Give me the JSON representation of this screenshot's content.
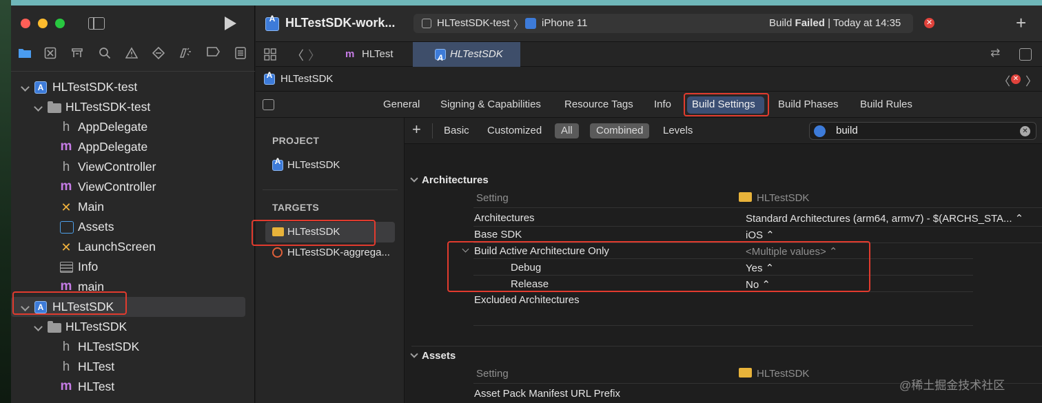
{
  "navigator": {
    "tree": [
      {
        "label": "HLTestSDK-test",
        "icon": "project-icon",
        "level": 0,
        "disclosure": true
      },
      {
        "label": "HLTestSDK-test",
        "icon": "folder-icon",
        "level": 1,
        "disclosure": true
      },
      {
        "label": "AppDelegate",
        "icon": "h-file-icon",
        "level": 2
      },
      {
        "label": "AppDelegate",
        "icon": "m-file-icon",
        "level": 2
      },
      {
        "label": "ViewController",
        "icon": "h-file-icon",
        "level": 2
      },
      {
        "label": "ViewController",
        "icon": "m-file-icon",
        "level": 2
      },
      {
        "label": "Main",
        "icon": "storyboard-icon",
        "level": 2
      },
      {
        "label": "Assets",
        "icon": "assets-icon",
        "level": 2
      },
      {
        "label": "LaunchScreen",
        "icon": "storyboard-icon",
        "level": 2
      },
      {
        "label": "Info",
        "icon": "plist-icon",
        "level": 2
      },
      {
        "label": "main",
        "icon": "m-file-icon",
        "level": 2
      },
      {
        "label": "HLTestSDK",
        "icon": "project-icon",
        "level": 0,
        "disclosure": true,
        "selected": true
      },
      {
        "label": "HLTestSDK",
        "icon": "folder-icon",
        "level": 1,
        "disclosure": true
      },
      {
        "label": "HLTestSDK",
        "icon": "h-file-icon",
        "level": 2
      },
      {
        "label": "HLTest",
        "icon": "h-file-icon",
        "level": 2
      },
      {
        "label": "HLTest",
        "icon": "m-file-icon",
        "level": 2
      }
    ]
  },
  "toolbar": {
    "title": "HLTestSDK-work...",
    "scheme": "HLTestSDK-test",
    "device": "iPhone 11",
    "status_prefix": "Build",
    "status_bold": "Failed",
    "status_suffix": "| Today at 14:35",
    "error_glyph": "✕",
    "add_glyph": "+"
  },
  "tabs": [
    {
      "label": "HLTest",
      "icon": "m-file-icon",
      "active": false
    },
    {
      "label": "HLTestSDK",
      "icon": "project-icon",
      "active": true
    }
  ],
  "jumpbar": {
    "label": "HLTestSDK"
  },
  "settings_tabs": [
    "General",
    "Signing & Capabilities",
    "Resource Tags",
    "Info",
    "Build Settings",
    "Build Phases",
    "Build Rules"
  ],
  "targets_panel": {
    "project_header": "PROJECT",
    "project_item": "HLTestSDK",
    "targets_header": "TARGETS",
    "targets": [
      "HLTestSDK",
      "HLTestSDK-aggrega..."
    ]
  },
  "filters": {
    "add": "+",
    "buttons": [
      "Basic",
      "Customized",
      "All",
      "Combined",
      "Levels"
    ],
    "search_value": "build"
  },
  "sections": {
    "architectures": {
      "title": "Architectures",
      "col_setting": "Setting",
      "col_target": "HLTestSDK",
      "rows": [
        {
          "name": "Architectures",
          "value": "Standard Architectures (arm64, armv7)  -  $(ARCHS_STA... ⌃"
        },
        {
          "name": "Base SDK",
          "value": "iOS ⌃"
        },
        {
          "name": "Build Active Architecture Only",
          "value": "<Multiple values> ⌃"
        },
        {
          "name": "Debug",
          "value": "Yes ⌃"
        },
        {
          "name": "Release",
          "value": "No ⌃"
        },
        {
          "name": "Excluded Architectures",
          "value": ""
        }
      ]
    },
    "assets": {
      "title": "Assets",
      "col_setting": "Setting",
      "col_target": "HLTestSDK",
      "rows": [
        {
          "name": "Asset Pack Manifest URL Prefix",
          "value": ""
        }
      ]
    }
  },
  "watermark": "@稀土掘金技术社区",
  "colors": {
    "highlight": "#e23b2e",
    "accent": "#3d7bd9",
    "error": "#e0423b"
  }
}
